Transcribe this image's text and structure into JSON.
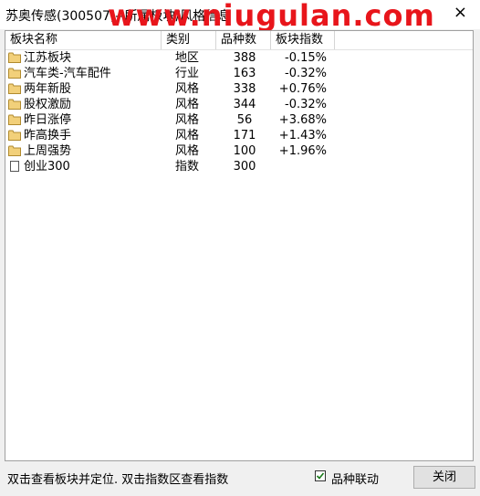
{
  "window": {
    "title": "苏奥传感(300507)--所属板块/风格信息",
    "watermark": "www.niugulan.com",
    "close_glyph": "×"
  },
  "table": {
    "headers": [
      "板块名称",
      "类别",
      "品种数",
      "板块指数"
    ],
    "rows": [
      {
        "name": "江苏板块",
        "category": "地区",
        "count": "388",
        "index": "-0.15%",
        "icon": "folder-icon"
      },
      {
        "name": "汽车类-汽车配件",
        "category": "行业",
        "count": "163",
        "index": "-0.32%",
        "icon": "folder-icon"
      },
      {
        "name": "两年新股",
        "category": "风格",
        "count": "338",
        "index": "+0.76%",
        "icon": "folder-icon"
      },
      {
        "name": "股权激励",
        "category": "风格",
        "count": "344",
        "index": "-0.32%",
        "icon": "folder-icon"
      },
      {
        "name": "昨日涨停",
        "category": "风格",
        "count": "56",
        "index": "+3.68%",
        "icon": "folder-icon"
      },
      {
        "name": "昨高换手",
        "category": "风格",
        "count": "171",
        "index": "+1.43%",
        "icon": "folder-icon"
      },
      {
        "name": "上周强势",
        "category": "风格",
        "count": "100",
        "index": "+1.96%",
        "icon": "folder-icon"
      },
      {
        "name": "创业300",
        "category": "指数",
        "count": "300",
        "index": "",
        "icon": "document-icon"
      }
    ]
  },
  "footer": {
    "hint": "双击查看板块并定位. 双击指数区查看指数",
    "linkage_label": "品种联动",
    "linkage_checked": true,
    "close_label": "关闭"
  },
  "colors": {
    "folder_fill": "#f2d07a",
    "folder_stroke": "#b08a2e",
    "watermark": "#e8151b"
  }
}
